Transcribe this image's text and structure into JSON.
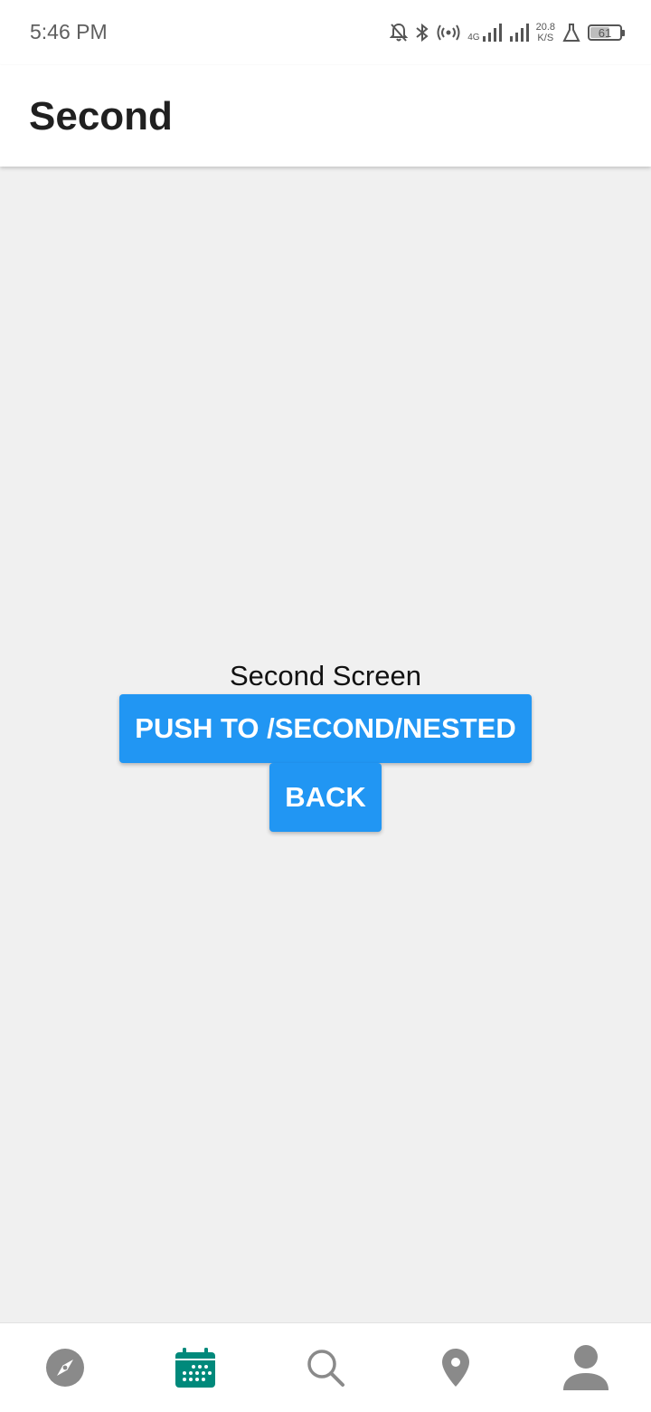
{
  "status_bar": {
    "time": "5:46 PM",
    "network_type": "4G",
    "net_speed_value": "20.8",
    "net_speed_unit": "K/S",
    "battery_level": "61"
  },
  "app_bar": {
    "title": "Second"
  },
  "main": {
    "screen_label": "Second Screen",
    "push_button_label": "PUSH TO /SECOND/NESTED",
    "back_button_label": "BACK"
  },
  "bottom_nav": {
    "items": [
      {
        "icon": "compass-icon",
        "active": false
      },
      {
        "icon": "calendar-icon",
        "active": true
      },
      {
        "icon": "search-icon",
        "active": false
      },
      {
        "icon": "location-pin-icon",
        "active": false
      },
      {
        "icon": "person-icon",
        "active": false
      }
    ]
  },
  "colors": {
    "accent": "#2196f3",
    "active_nav": "#00897b",
    "inactive_nav": "#8a8a8a",
    "background": "#f0f0f0"
  }
}
